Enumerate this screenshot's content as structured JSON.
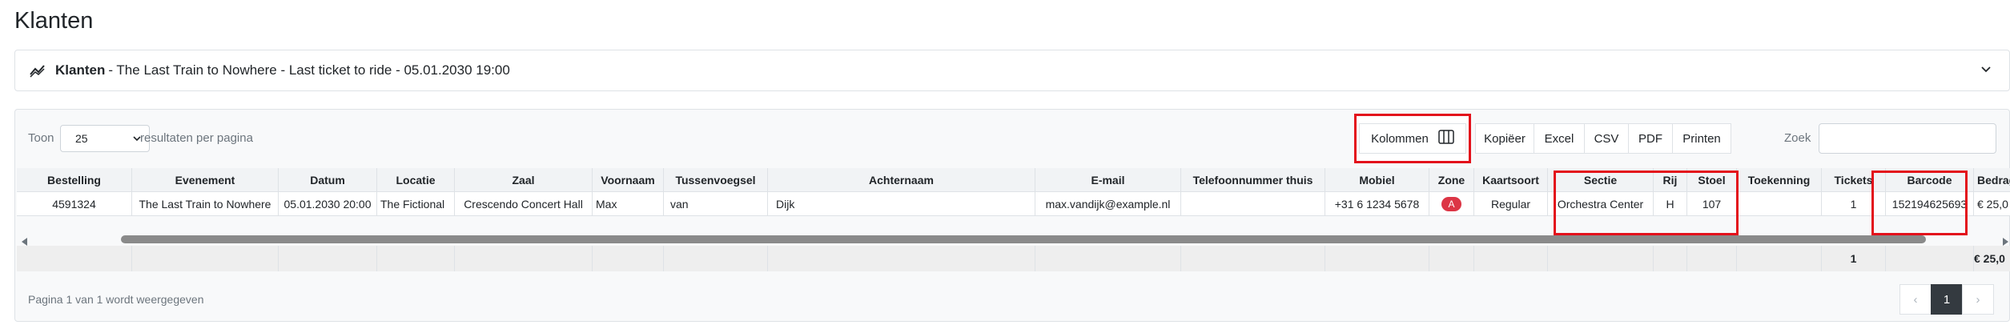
{
  "page": {
    "title": "Klanten"
  },
  "event": {
    "label": "Klanten",
    "detail": "- The Last Train to Nowhere - Last ticket to ride - 05.01.2030 19:00"
  },
  "toolbar": {
    "show_label": "Toon",
    "page_size": "25",
    "per_page_label": "resultaten per pagina",
    "buttons": [
      "Kolommen",
      "Kopiëer",
      "Excel",
      "CSV",
      "PDF",
      "Printen"
    ],
    "search_label": "Zoek",
    "search_value": ""
  },
  "table": {
    "headers": [
      "Bestelling",
      "Evenement",
      "Datum",
      "Locatie",
      "Zaal",
      "Voornaam",
      "Tussenvoegsel",
      "Achternaam",
      "E-mail",
      "Telefoonnummer thuis",
      "Mobiel",
      "Zone",
      "Kaartsoort",
      "Sectie",
      "Rij",
      "Stoel",
      "Toekenning",
      "Tickets",
      "Barcode",
      "Bedrag"
    ],
    "rows": [
      [
        "4591324",
        "The Last Train to Nowhere",
        "05.01.2030 20:00",
        "The Fictional",
        "Crescendo Concert Hall",
        "Max",
        "van",
        "Dijk",
        "max.vandijk@example.nl",
        "",
        "+31 6 1234 5678",
        "A",
        "Regular",
        "Orchestra Center",
        "H",
        "107",
        "",
        "1",
        "152194625693",
        "€ 25,0"
      ]
    ],
    "totals": {
      "tickets": "1",
      "amount": "€ 25,0"
    }
  },
  "footer": {
    "info": "Pagina 1 van 1 wordt weergegeven",
    "pages": [
      "‹",
      "1",
      "›"
    ],
    "active_page": "1"
  },
  "colors": {
    "highlight": "#e3101b",
    "zone_badge": "#dc3545",
    "active_page": "#343a40"
  }
}
